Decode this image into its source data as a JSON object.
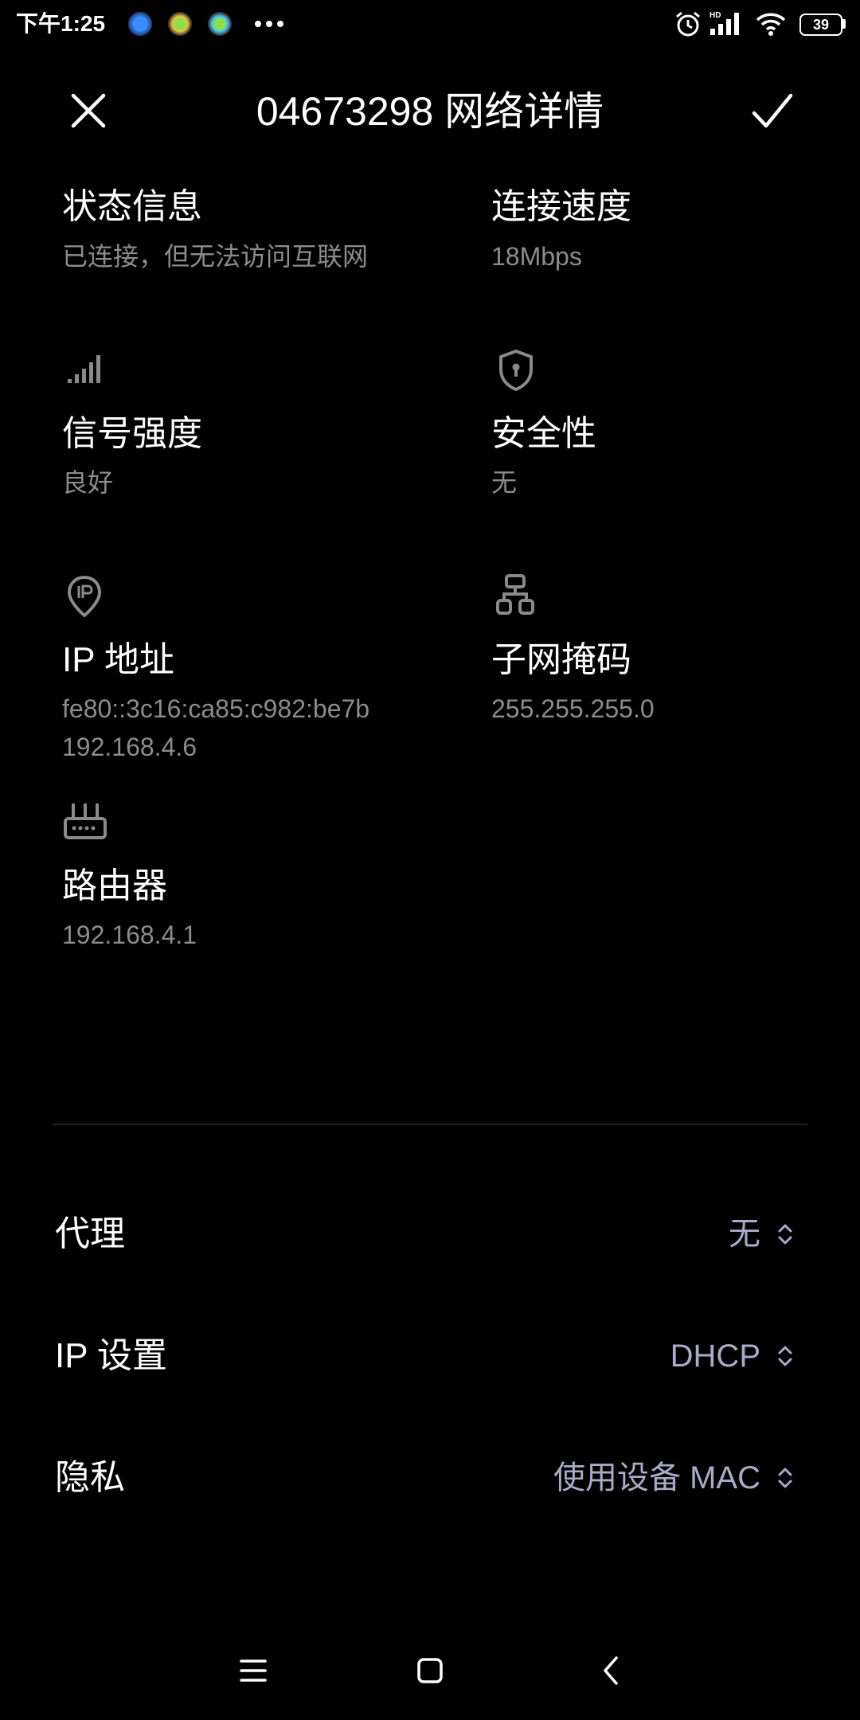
{
  "colors": {
    "background": "#000000",
    "primary_text": "#ffffff",
    "secondary_text": "#8c8c8c",
    "value_accent": "#a9a9c8",
    "icon_gray": "#8a8a8a"
  },
  "status_bar": {
    "time": "下午1:25",
    "notification_icons": [
      "k-app-icon",
      "green-app-icon",
      "green-app-icon",
      "more-dots-icon"
    ],
    "system_icons": [
      "alarm-icon",
      "hd-signal-icon",
      "wifi-icon",
      "battery-icon"
    ],
    "network_label": "HD",
    "battery": "39"
  },
  "header": {
    "title": "04673298 网络详情",
    "close_icon": "close-icon",
    "confirm_icon": "check-icon"
  },
  "details": [
    {
      "label": "状态信息",
      "values": [
        "已连接，但无法访问互联网"
      ]
    },
    {
      "label": "连接速度",
      "values": [
        "18Mbps"
      ]
    },
    {
      "label": "信号强度",
      "icon": "signal-strength-icon",
      "values": [
        "良好"
      ]
    },
    {
      "label": "安全性",
      "icon": "shield-icon",
      "values": [
        "无"
      ]
    },
    {
      "label": "IP 地址",
      "icon": "ip-location-icon",
      "values": [
        "fe80::3c16:ca85:c982:be7b",
        "192.168.4.6"
      ]
    },
    {
      "label": "子网掩码",
      "icon": "subnet-icon",
      "values": [
        "255.255.255.0"
      ]
    },
    {
      "label": "路由器",
      "icon": "router-icon",
      "values": [
        "192.168.4.1"
      ]
    }
  ],
  "settings": [
    {
      "label": "代理",
      "value": "无",
      "icon": "chevron-up-down-icon"
    },
    {
      "label": "IP 设置",
      "value": "DHCP",
      "icon": "chevron-up-down-icon"
    },
    {
      "label": "隐私",
      "value": "使用设备 MAC",
      "icon": "chevron-up-down-icon"
    }
  ],
  "nav_bar": {
    "icons": [
      "menu-icon",
      "home-icon",
      "back-icon"
    ]
  }
}
